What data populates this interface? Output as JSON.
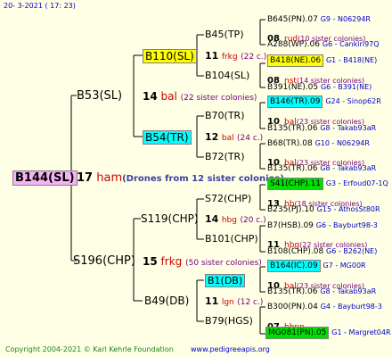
{
  "header": {
    "date": "20-  3-2021",
    "time": "( 17: 23)"
  },
  "root": {
    "name": "B144(SL)",
    "num": "17",
    "tag": "ham",
    "drones": "(Drones from 12 sister colonies)"
  },
  "gen1": [
    {
      "name": "B53(SL)",
      "num": "14",
      "tag": "bal",
      "note": "(22 sister colonies)"
    },
    {
      "name": "S196(CHP)",
      "num": "15",
      "tag": "frkg",
      "note": "(50 sister colonies)"
    }
  ],
  "gen2": [
    {
      "name": "B110(SL)",
      "num": "11",
      "tag": "frkg",
      "note": "(22 c.)"
    },
    {
      "name": "B54(TR)",
      "num": "12",
      "tag": "bal",
      "note": "(24 c.)"
    },
    {
      "name": "S119(CHP)",
      "num": "14",
      "tag": "hbg",
      "note": "(20 c.)"
    },
    {
      "name": "B49(DB)",
      "num": "11",
      "tag": "lgn",
      "note": "(12 c.)"
    }
  ],
  "gen3": [
    {
      "name": "B45(TP)"
    },
    {
      "name": "B104(SL)"
    },
    {
      "name": "B70(TR)"
    },
    {
      "name": "B72(TR)"
    },
    {
      "name": "S72(CHP)"
    },
    {
      "name": "B101(CHP)"
    },
    {
      "name": "B1(DB)"
    },
    {
      "name": "B79(HGS)"
    }
  ],
  "gen3_desc": [
    {
      "num": "08",
      "tag": "rud",
      "note": "(10 sister colonies)"
    },
    {
      "num": "08",
      "tag": "nst",
      "note": "(14 sister colonies)"
    },
    {
      "num": "10",
      "tag": "bal",
      "note": "(23 sister colonies)"
    },
    {
      "num": "10",
      "tag": "bal",
      "note": "(23 sister colonies)"
    },
    {
      "num": "13",
      "tag": "hb",
      "note": "(18 sister colonies)"
    },
    {
      "num": "11",
      "tag": "hbg",
      "note": "(22 sister colonies)"
    },
    {
      "num": "10",
      "tag": "bal",
      "note": "(23 sister colonies)"
    },
    {
      "num": "07",
      "tag": "hbpn",
      "note": ""
    }
  ],
  "gen4": [
    {
      "left": "B645(PN).07",
      "right": "G9 - N06294R"
    },
    {
      "left": "A288(WP).06",
      "right": "G6 - Cankiri97Q"
    },
    {
      "left": "B418(NE).06",
      "right": "G1 - B418(NE)"
    },
    {
      "left": "B391(NE).05",
      "right": "G6 - B391(NE)"
    },
    {
      "left": "B146(TR).09",
      "right": "G24 - Sinop62R"
    },
    {
      "left": "B135(TR).06",
      "right": "G8 - Takab93aR"
    },
    {
      "left": "B68(TR).08",
      "right": "G10 - N06294R"
    },
    {
      "left": "B135(TR).06",
      "right": "G8 - Takab93aR"
    },
    {
      "left": "S41(CHP).11",
      "right": "G3 - Erfoud07-1Q"
    },
    {
      "left": "B235(PJ).10",
      "right": "G15 - AthosSt80R"
    },
    {
      "left": "B7(HSB).09",
      "right": "G6 - Bayburt98-3"
    },
    {
      "left": "B108(CHP).08",
      "right": "G6 - B262(NE)"
    },
    {
      "left": "B164(IC).09",
      "right": "G7 - MG00R"
    },
    {
      "left": "B135(TR).06",
      "right": "G8 - Takab93aR"
    },
    {
      "left": "B300(PN).04",
      "right": "G4 - Bayburt98-3"
    },
    {
      "left": "MG081(PN).05",
      "right": "G1 - Margret04R"
    }
  ],
  "footer": {
    "copyright": "Copyright 2004-2021 © Karl Kehrle Foundation",
    "url": "www.pedigreeapis.org"
  }
}
